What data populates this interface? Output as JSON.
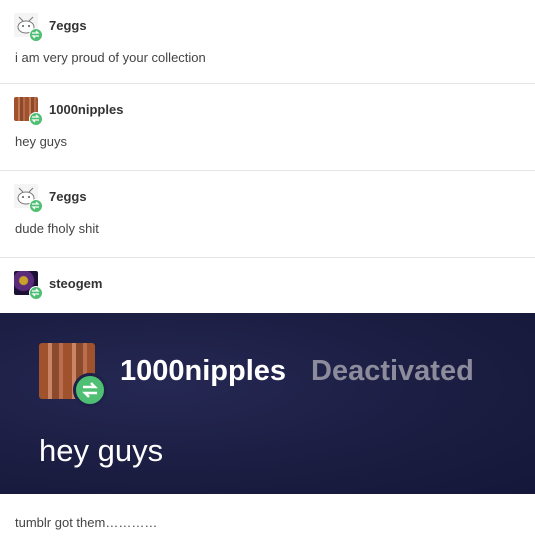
{
  "thread": [
    {
      "username": "7eggs",
      "text": "i am very proud of your collection",
      "avatar_icon": "cat-doodle-avatar"
    },
    {
      "username": "1000nipples",
      "text": "hey guys",
      "avatar_icon": "wood-pattern-avatar"
    },
    {
      "username": "7eggs",
      "text": "dude fholy shit",
      "avatar_icon": "cat-doodle-avatar"
    },
    {
      "username": "steogem",
      "text": "",
      "avatar_icon": "dark-abstract-avatar"
    }
  ],
  "screenshot": {
    "username": "1000nipples",
    "status": "Deactivated",
    "text": "hey guys"
  },
  "caption": "tumblr got them…………",
  "colors": {
    "reblog_badge": "#4fbf73",
    "screenshot_bg": "#1e2148",
    "deactivated": "#8c8c9c"
  }
}
